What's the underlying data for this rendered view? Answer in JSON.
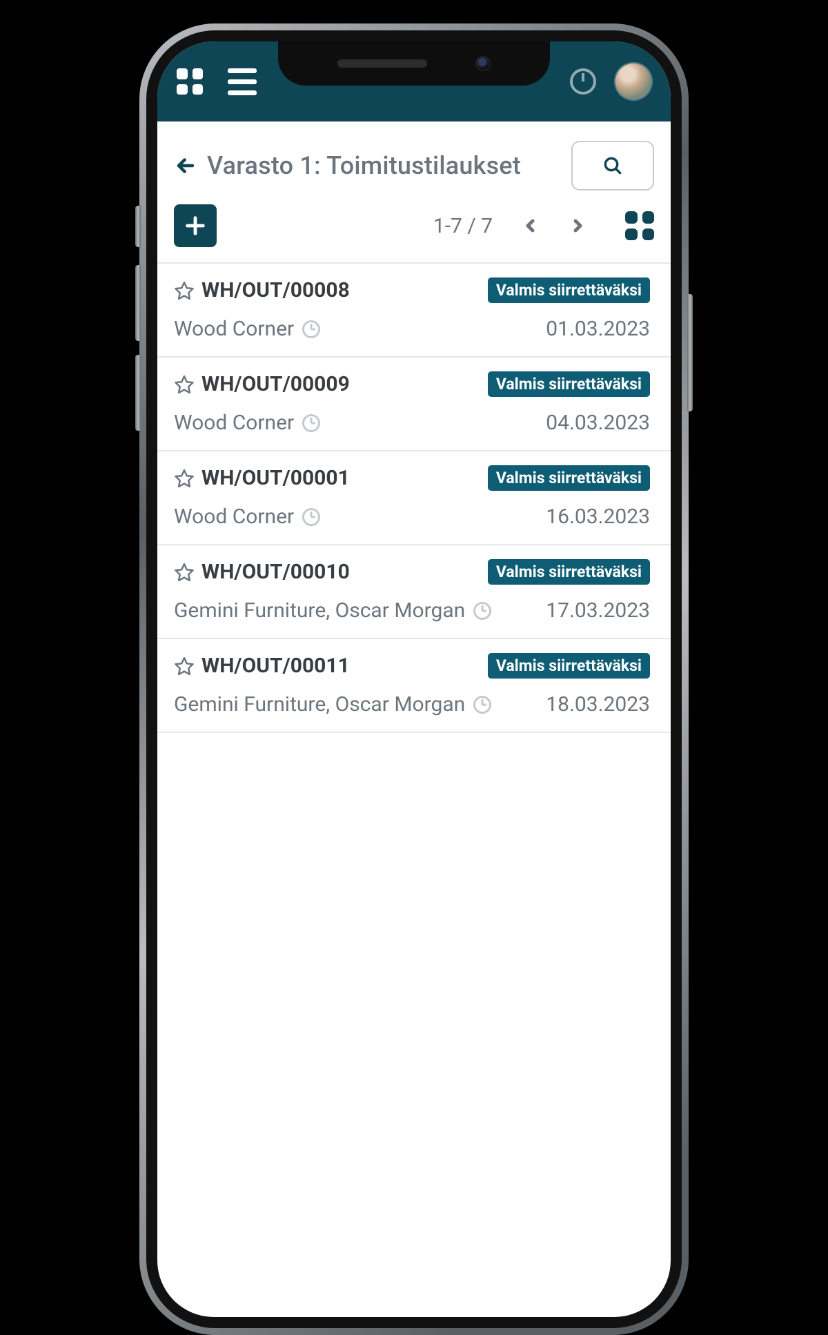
{
  "colors": {
    "brand": "#0f4656",
    "badge": "#0f5d74",
    "text_muted": "#6c757d"
  },
  "title": "Varasto 1: Toimitustilaukset",
  "pager": "1-7 / 7",
  "status_label": "Valmis siirrettäväksi",
  "orders": [
    {
      "code": "WH/OUT/00008",
      "partner": "Wood Corner",
      "date": "01.03.2023",
      "status": "Valmis siirrettäväksi"
    },
    {
      "code": "WH/OUT/00009",
      "partner": "Wood Corner",
      "date": "04.03.2023",
      "status": "Valmis siirrettäväksi"
    },
    {
      "code": "WH/OUT/00001",
      "partner": "Wood Corner",
      "date": "16.03.2023",
      "status": "Valmis siirrettäväksi"
    },
    {
      "code": "WH/OUT/00010",
      "partner": "Gemini Furniture, Oscar Morgan",
      "date": "17.03.2023",
      "status": "Valmis siirrettäväksi"
    },
    {
      "code": "WH/OUT/00011",
      "partner": "Gemini Furniture, Oscar Morgan",
      "date": "18.03.2023",
      "status": "Valmis siirrettäväksi"
    }
  ]
}
